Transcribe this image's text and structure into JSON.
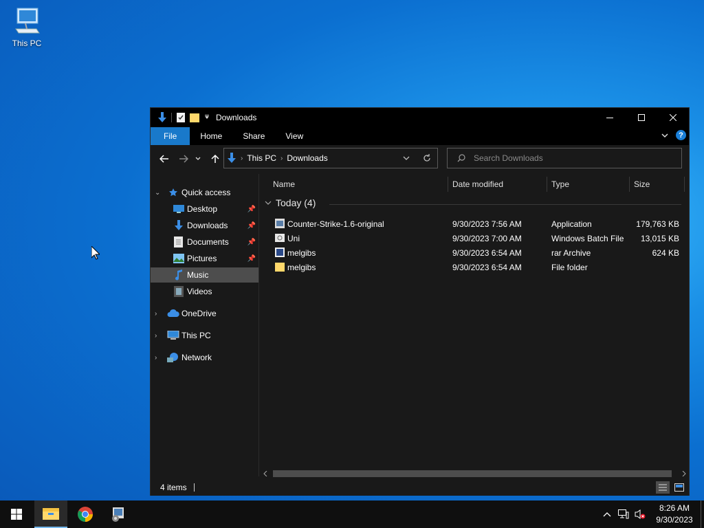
{
  "desktop": {
    "icon_label": "This PC"
  },
  "window": {
    "title": "Downloads",
    "ribbon_tabs": [
      "File",
      "Home",
      "Share",
      "View"
    ],
    "help_label": "?",
    "address": {
      "root": "This PC",
      "current": "Downloads"
    },
    "search_placeholder": "Search Downloads",
    "nav": {
      "quick_access": "Quick access",
      "desktop": "Desktop",
      "downloads": "Downloads",
      "documents": "Documents",
      "pictures": "Pictures",
      "music": "Music",
      "videos": "Videos",
      "onedrive": "OneDrive",
      "this_pc": "This PC",
      "network": "Network"
    },
    "columns": {
      "name": "Name",
      "date": "Date modified",
      "type": "Type",
      "size": "Size"
    },
    "group_label": "Today (4)",
    "files": [
      {
        "name": "Counter-Strike-1.6-original",
        "date": "9/30/2023 7:56 AM",
        "type": "Application",
        "size": "179,763 KB",
        "icon": "application-icon"
      },
      {
        "name": "Uni",
        "date": "9/30/2023 7:00 AM",
        "type": "Windows Batch File",
        "size": "13,015 KB",
        "icon": "batch-file-icon"
      },
      {
        "name": "melgibs",
        "date": "9/30/2023 6:54 AM",
        "type": "rar Archive",
        "size": "624 KB",
        "icon": "archive-icon"
      },
      {
        "name": "melgibs",
        "date": "9/30/2023 6:54 AM",
        "type": "File folder",
        "size": "",
        "icon": "folder-icon"
      }
    ],
    "status": "4 items"
  },
  "taskbar": {
    "time": "8:26 AM",
    "date": "9/30/2023"
  },
  "colors": {
    "accent": "#1979ca",
    "window_bg": "#191919",
    "selected": "#4d4d4d"
  }
}
